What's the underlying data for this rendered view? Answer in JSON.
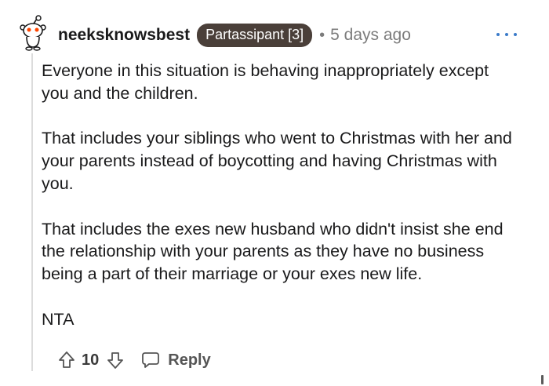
{
  "comment": {
    "username": "neeksknowsbest",
    "flair": "Partassipant [3]",
    "separator": "•",
    "timestamp": "5 days ago",
    "paragraphs": [
      "Everyone in this situation is behaving inappropriately except you and the children.",
      "That includes your siblings who went to Christmas with her and your parents instead of boycotting and having Christmas with you.",
      "That includes the exes new husband who didn't insist she end the relationship with your parents as they have no business being a part of their marriage or your exes new life.",
      "NTA"
    ],
    "score": "10",
    "reply_label": "Reply"
  },
  "icons": {
    "avatar": "reddit-snoo-avatar-icon",
    "more": "more-options-icon",
    "upvote": "upvote-arrow-icon",
    "downvote": "downvote-arrow-icon",
    "reply": "speech-bubble-icon"
  },
  "colors": {
    "flair_bg": "#4a3f39",
    "accent_blue": "#3b7bc9",
    "muted_text": "#7c7c7c",
    "thread_line": "#dcdcdc"
  }
}
